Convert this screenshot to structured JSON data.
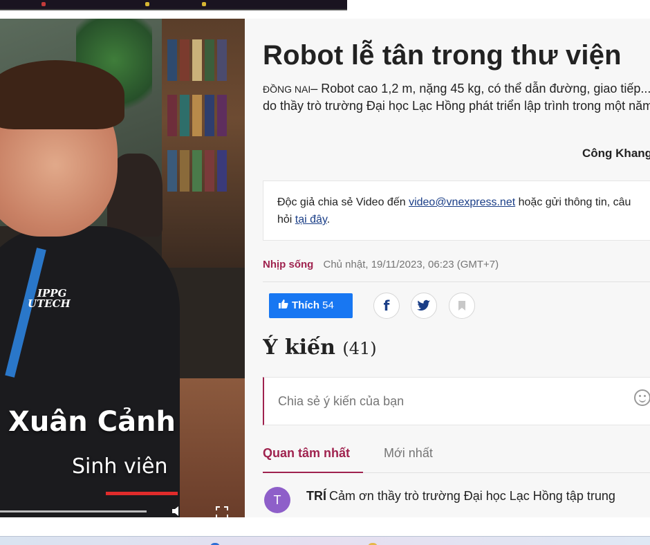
{
  "video": {
    "caption_name": "Xuân Cảnh",
    "caption_role": "Sinh viên",
    "logo_line1": "IPPG",
    "logo_line2": "UTECH"
  },
  "article": {
    "title": "Robot lễ tân trong thư viện",
    "location": "ĐỒNG NAI",
    "lead": "– Robot cao 1,2 m, nặng 45 kg, có thể dẫn đường, giao tiếp... do thầy trò trường Đại học Lạc Hồng phát triển lập trình trong một năm.",
    "author": "Công Khang"
  },
  "share_box": {
    "text_before": "Độc giả chia sẻ Video đến ",
    "email": "video@vnexpress.net",
    "text_middle": " hoặc gửi thông tin, câu hỏi ",
    "link": "tại đây",
    "text_end": "."
  },
  "meta": {
    "category": "Nhịp sống",
    "datetime": "Chủ nhật, 19/11/2023, 06:23 (GMT+7)"
  },
  "actions": {
    "like_label": "Thích",
    "like_count": "54",
    "facebook_glyph": "f"
  },
  "comments": {
    "heading": "Ý kiến",
    "count": "(41)",
    "input_placeholder": "Chia sẻ ý kiến của bạn",
    "tab_top": "Quan tâm nhất",
    "tab_new": "Mới nhất",
    "first": {
      "avatar_letter": "T",
      "user": "TRÍ",
      "text": "Cảm ơn thầy trò trường Đại học Lạc Hồng tập trung"
    }
  },
  "colors": {
    "accent": "#9f224e",
    "facebook_blue": "#1877f2",
    "link_blue": "#1a3e87",
    "avatar_purple": "#8e5fc9"
  }
}
